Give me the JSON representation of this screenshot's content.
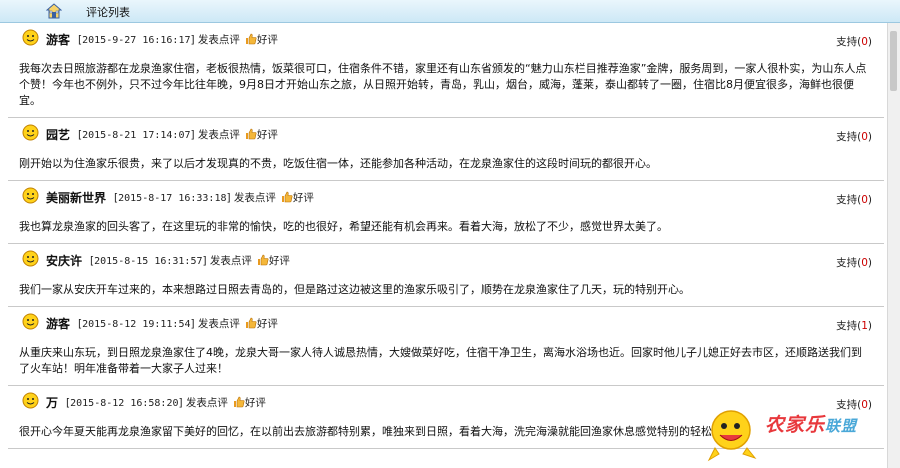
{
  "header": {
    "title": "评论列表"
  },
  "labels": {
    "post_comment": "发表点评",
    "good": "好评",
    "support": "支持"
  },
  "comments": [
    {
      "user": "游客",
      "date": "2015-9-27 16:16:17",
      "support_count": "0",
      "text": "我每次去日照旅游都在龙泉渔家住宿，老板很热情，饭菜很可口，住宿条件不错，家里还有山东省颁发的“魅力山东栏目推荐渔家”金牌，服务周到，一家人很朴实，为山东人点个赞！今年也不例外，只不过今年比往年晚，9月8日才开始山东之旅，从日照开始转，青岛，乳山，烟台，威海，蓬莱，泰山都转了一圈，住宿比8月便宜很多，海鲜也很便宜。"
    },
    {
      "user": "园艺",
      "date": "2015-8-21 17:14:07",
      "support_count": "0",
      "text": "刚开始以为住渔家乐很贵，来了以后才发现真的不贵，吃饭住宿一体，还能参加各种活动，在龙泉渔家住的这段时间玩的都很开心。"
    },
    {
      "user": "美丽新世界",
      "date": "2015-8-17 16:33:18",
      "support_count": "0",
      "text": "我也算龙泉渔家的回头客了，在这里玩的非常的愉快，吃的也很好，希望还能有机会再来。看着大海，放松了不少，感觉世界太美了。"
    },
    {
      "user": "安庆许",
      "date": "2015-8-15 16:31:57",
      "support_count": "0",
      "text": "我们一家从安庆开车过来的，本来想路过日照去青岛的，但是路过这边被这里的渔家乐吸引了，顺势在龙泉渔家住了几天，玩的特别开心。"
    },
    {
      "user": "游客",
      "date": "2015-8-12 19:11:54",
      "support_count": "1",
      "text": "从重庆来山东玩，到日照龙泉渔家住了4晚，龙泉大哥一家人待人诚恳热情，大嫂做菜好吃，住宿干净卫生，离海水浴场也近。回家时他儿子儿媳正好去市区，还顺路送我们到了火车站！明年准备带着一大家子人过来！"
    },
    {
      "user": "万",
      "date": "2015-8-12 16:58:20",
      "support_count": "0",
      "text": "很开心今年夏天能再龙泉渔家留下美好的回忆，在以前出去旅游都特别累，唯独来到日照，看着大海，洗完海澡就能回渔家休息感觉特别的轻松。"
    }
  ],
  "watermark": {
    "main": "农家乐",
    "tail": "联盟"
  },
  "colors": {
    "header_bg": "#cde8f6",
    "support_count": "#cc0000",
    "logo_red": "#e8383c",
    "logo_blue": "#4aa8d8"
  }
}
